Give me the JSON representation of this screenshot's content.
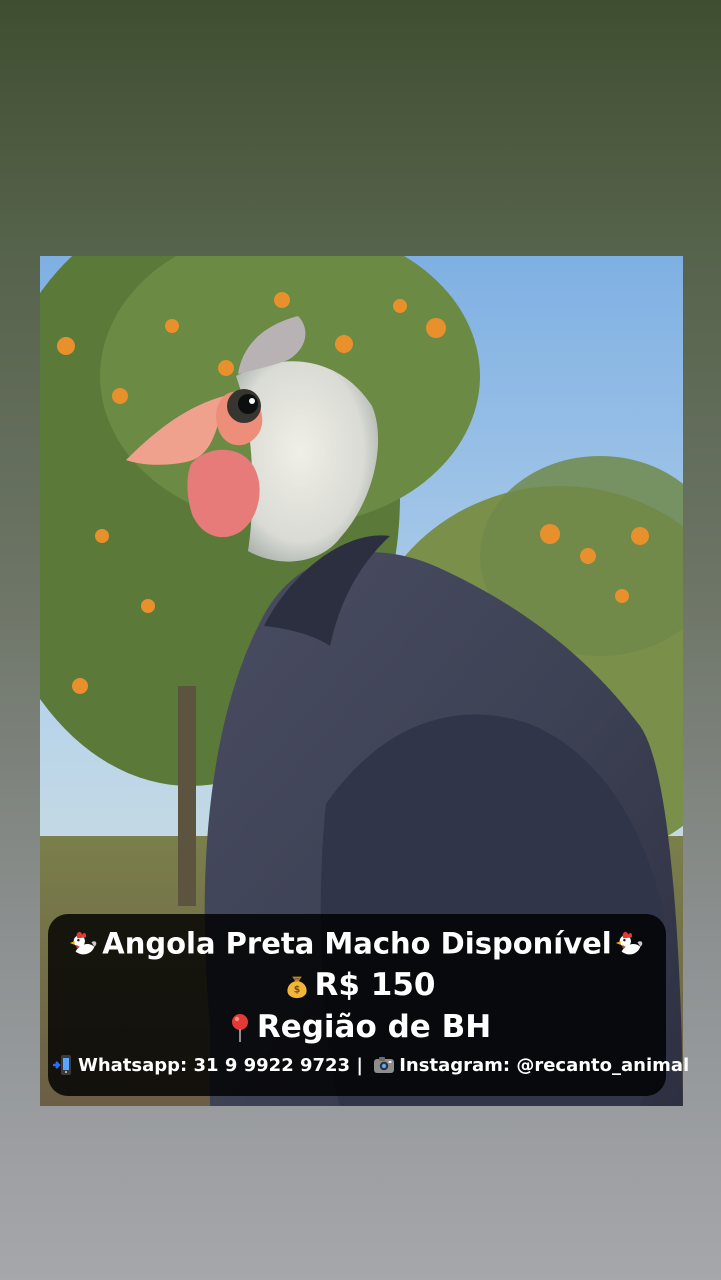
{
  "caption": {
    "title": "Angola Preta Macho Disponível",
    "price": "R$ 150",
    "region": "Região de BH",
    "whatsapp": "Whatsapp: 31 9 9922 9723",
    "separator": "|",
    "instagram": "Instagram: @recanto_animal"
  },
  "icons": {
    "title_left": "rooster-icon",
    "title_right": "rooster-icon",
    "price": "money-bag-icon",
    "region": "location-pin-icon",
    "whatsapp": "mobile-phone-arrow-icon",
    "instagram": "camera-icon"
  },
  "colors": {
    "caption_background": "#000000",
    "caption_text": "#ffffff",
    "background_top": "#3f4d30",
    "background_bottom": "#a6a7ab"
  }
}
